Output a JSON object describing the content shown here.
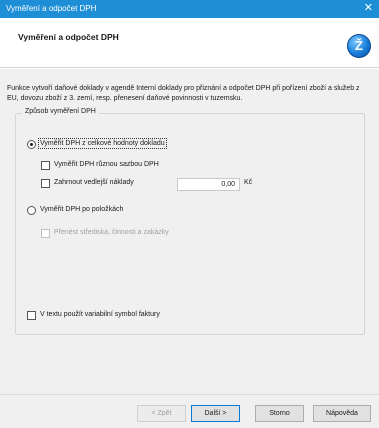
{
  "window": {
    "title": "Vyměření a odpočet DPH",
    "close_glyph": "✕"
  },
  "header": {
    "title": "Vyměření a odpočet DPH",
    "logo_glyph": "Ž",
    "logo_icon": "wizard-logo-icon"
  },
  "description": "Funkce vytvoří daňové doklady v agendě Interní doklady pro přiznání a odpočet DPH při pořízení zboží a služeb z EU, dovozu zboží z 3. zemí, resp. přenesení daňové povinnosti v tuzemsku.",
  "group": {
    "legend": "Způsob vyměření DPH",
    "option_whole": {
      "label": "Vyměřit DPH z celkové hodnoty dokladu",
      "checked": true
    },
    "check_multi_rate": {
      "label": "Vyměřit DPH různou sazbou DPH",
      "checked": false
    },
    "check_extra_costs": {
      "label": "Zahrnout vedlejší náklady",
      "checked": false
    },
    "extra_costs_amount": "0,00",
    "currency": "Kč",
    "option_items": {
      "label": "Vyměřit DPH po položkách",
      "checked": false
    },
    "check_transfer": {
      "label": "Přenést střediska, činnosti a zakázky",
      "checked": false,
      "disabled": true
    },
    "check_varsymbol": {
      "label": "V textu použít variabilní symbol faktury",
      "checked": false
    }
  },
  "footer": {
    "back_label": "< Zpět",
    "next_label": "Další >",
    "cancel_label": "Storno",
    "help_label": "Nápověda"
  },
  "colors": {
    "titlebar": "#1e8fd6",
    "dialog_bg": "#f0f0f0",
    "accent": "#0a78d7"
  }
}
